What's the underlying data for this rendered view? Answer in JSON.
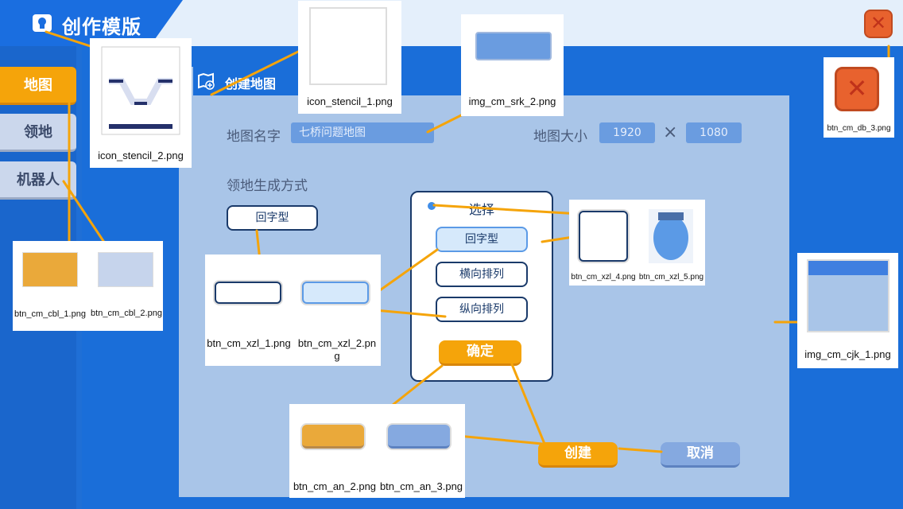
{
  "header": {
    "title": "创作模版"
  },
  "nav": {
    "items": [
      {
        "label": "地图"
      },
      {
        "label": "领地"
      },
      {
        "label": "机器人"
      }
    ]
  },
  "panel": {
    "title": "创建地图",
    "map_name_label": "地图名字",
    "map_name_value": "七桥问题地图",
    "map_size_label": "地图大小",
    "width": "1920",
    "times": "×",
    "height": "1080",
    "territory_label": "领地生成方式",
    "territory_value": "回字型"
  },
  "dropdown": {
    "title": "选择",
    "options": [
      "回字型",
      "横向排列",
      "纵向排列"
    ],
    "confirm": "确定"
  },
  "actions": {
    "create": "创建",
    "cancel": "取消"
  },
  "sprites": {
    "icon_stencil_2": "icon_stencil_2.png",
    "icon_stencil_1": "icon_stencil_1.png",
    "img_cm_srk_2": "img_cm_srk_2.png",
    "btn_cm_db_3": "btn_cm_db_3.png",
    "btn_cm_cbl_1": "btn_cm_cbl_1.png",
    "btn_cm_cbl_2": "btn_cm_cbl_2.png",
    "btn_cm_xzl_1": "btn_cm_xzl_1.png",
    "btn_cm_xzl_2": "btn_cm_xzl_2.png",
    "btn_cm_xzl_4": "btn_cm_xzl_4.png",
    "btn_cm_xzl_5": "btn_cm_xzl_5.png",
    "img_cm_cjk_1": "img_cm_cjk_1.png",
    "btn_cm_an_2": "btn_cm_an_2.png",
    "btn_cm_an_3": "btn_cm_an_3.png"
  },
  "colors": {
    "accent_orange": "#f5a40a",
    "brand_blue": "#1a6ed9",
    "panel_light": "#a9c5e8",
    "close_red": "#e8622e"
  },
  "icons": [
    "bulb-icon",
    "map-plus-icon",
    "close-icon"
  ]
}
